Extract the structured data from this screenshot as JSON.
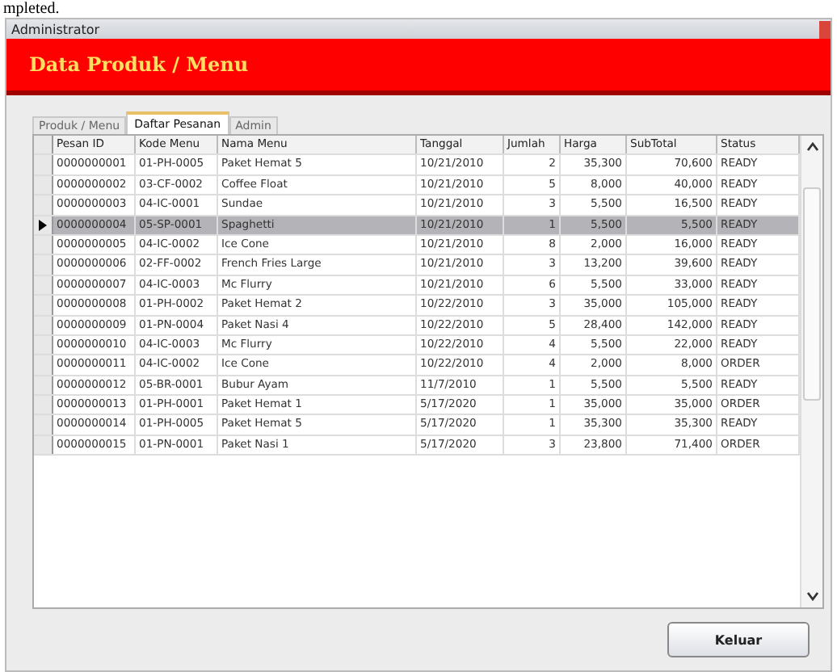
{
  "page_text": "mpleted.",
  "window": {
    "title": "Administrator"
  },
  "header": {
    "title": "Data Produk / Menu"
  },
  "tabs": [
    {
      "label": "Produk / Menu",
      "selected": false
    },
    {
      "label": "Daftar Pesanan",
      "selected": true
    },
    {
      "label": "Admin",
      "selected": false
    }
  ],
  "table": {
    "columns": [
      "Pesan ID",
      "Kode Menu",
      "Nama Menu",
      "Tanggal",
      "Jumlah",
      "Harga",
      "SubTotal",
      "Status"
    ],
    "rows": [
      {
        "selected": false,
        "cells": [
          "0000000001",
          "01-PH-0005",
          "Paket Hemat 5",
          "10/21/2010",
          "2",
          "35,300",
          "70,600",
          "READY"
        ]
      },
      {
        "selected": false,
        "cells": [
          "0000000002",
          "03-CF-0002",
          "Coffee Float",
          "10/21/2010",
          "5",
          "8,000",
          "40,000",
          "READY"
        ]
      },
      {
        "selected": false,
        "cells": [
          "0000000003",
          "04-IC-0001",
          "Sundae",
          "10/21/2010",
          "3",
          "5,500",
          "16,500",
          "READY"
        ]
      },
      {
        "selected": true,
        "cells": [
          "0000000004",
          "05-SP-0001",
          "Spaghetti",
          "10/21/2010",
          "1",
          "5,500",
          "5,500",
          "READY"
        ]
      },
      {
        "selected": false,
        "cells": [
          "0000000005",
          "04-IC-0002",
          "Ice Cone",
          "10/21/2010",
          "8",
          "2,000",
          "16,000",
          "READY"
        ]
      },
      {
        "selected": false,
        "cells": [
          "0000000006",
          "02-FF-0002",
          "French Fries Large",
          "10/21/2010",
          "3",
          "13,200",
          "39,600",
          "READY"
        ]
      },
      {
        "selected": false,
        "cells": [
          "0000000007",
          "04-IC-0003",
          "Mc Flurry",
          "10/21/2010",
          "6",
          "5,500",
          "33,000",
          "READY"
        ]
      },
      {
        "selected": false,
        "cells": [
          "0000000008",
          "01-PH-0002",
          "Paket Hemat 2",
          "10/22/2010",
          "3",
          "35,000",
          "105,000",
          "READY"
        ]
      },
      {
        "selected": false,
        "cells": [
          "0000000009",
          "01-PN-0004",
          "Paket Nasi 4",
          "10/22/2010",
          "5",
          "28,400",
          "142,000",
          "READY"
        ]
      },
      {
        "selected": false,
        "cells": [
          "0000000010",
          "04-IC-0003",
          "Mc Flurry",
          "10/22/2010",
          "4",
          "5,500",
          "22,000",
          "READY"
        ]
      },
      {
        "selected": false,
        "cells": [
          "0000000011",
          "04-IC-0002",
          "Ice Cone",
          "10/22/2010",
          "4",
          "2,000",
          "8,000",
          "ORDER"
        ]
      },
      {
        "selected": false,
        "cells": [
          "0000000012",
          "05-BR-0001",
          "Bubur Ayam",
          "11/7/2010",
          "1",
          "5,500",
          "5,500",
          "READY"
        ]
      },
      {
        "selected": false,
        "cells": [
          "0000000013",
          "01-PH-0001",
          "Paket Hemat 1",
          "5/17/2020",
          "1",
          "35,000",
          "35,000",
          "ORDER"
        ]
      },
      {
        "selected": false,
        "cells": [
          "0000000014",
          "01-PH-0005",
          "Paket Hemat 5",
          "5/17/2020",
          "1",
          "35,300",
          "35,300",
          "READY"
        ]
      },
      {
        "selected": false,
        "cells": [
          "0000000015",
          "01-PN-0001",
          "Paket Nasi 1",
          "5/17/2020",
          "3",
          "23,800",
          "71,400",
          "ORDER"
        ]
      }
    ]
  },
  "buttons": [
    "Keluar"
  ]
}
